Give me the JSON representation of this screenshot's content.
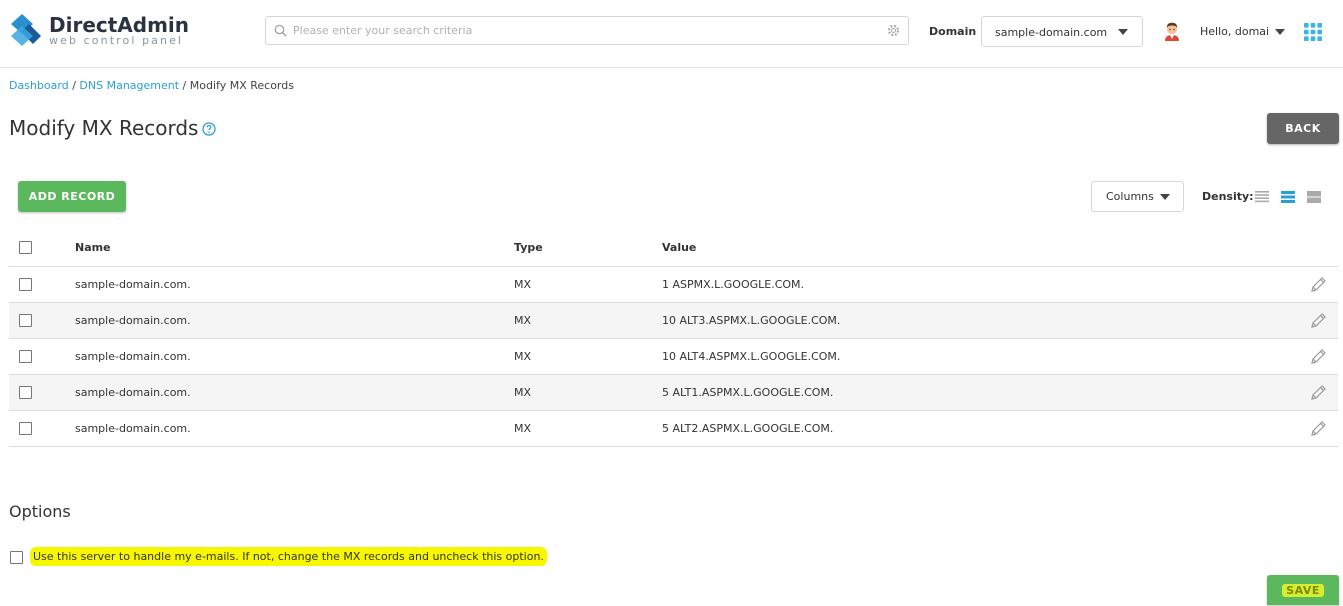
{
  "brand": {
    "title": "DirectAdmin",
    "subtitle": "web control panel"
  },
  "search": {
    "placeholder": "Please enter your search criteria",
    "value": ""
  },
  "domain": {
    "label": "Domain",
    "selected": "sample-domain.com"
  },
  "user": {
    "greeting": "Hello, domai"
  },
  "breadcrumb": {
    "items": [
      "Dashboard",
      "DNS Management"
    ],
    "separator": "/",
    "current": "Modify MX Records"
  },
  "page": {
    "title": "Modify MX Records"
  },
  "toolbar": {
    "back_label": "BACK",
    "add_label": "ADD RECORD",
    "columns_label": "Columns",
    "density_label": "Density:",
    "density_selected": "medium"
  },
  "table": {
    "columns": [
      "Name",
      "Type",
      "Value"
    ],
    "rows": [
      {
        "name": "sample-domain.com.",
        "type": "MX",
        "value": "1 ASPMX.L.GOOGLE.COM."
      },
      {
        "name": "sample-domain.com.",
        "type": "MX",
        "value": "10 ALT3.ASPMX.L.GOOGLE.COM."
      },
      {
        "name": "sample-domain.com.",
        "type": "MX",
        "value": "10 ALT4.ASPMX.L.GOOGLE.COM."
      },
      {
        "name": "sample-domain.com.",
        "type": "MX",
        "value": "5 ALT1.ASPMX.L.GOOGLE.COM."
      },
      {
        "name": "sample-domain.com.",
        "type": "MX",
        "value": "5 ALT2.ASPMX.L.GOOGLE.COM."
      }
    ]
  },
  "options": {
    "title": "Options",
    "handle_email_label": "Use this server to handle my e-mails. If not, change the MX records and uncheck this option.",
    "handle_email_checked": false
  },
  "footer": {
    "save_label": "SAVE"
  },
  "colors": {
    "accent": "#2a9fd6",
    "primary_button": "#5cb85c",
    "back_button": "#666666",
    "highlight": "#f7f700"
  }
}
